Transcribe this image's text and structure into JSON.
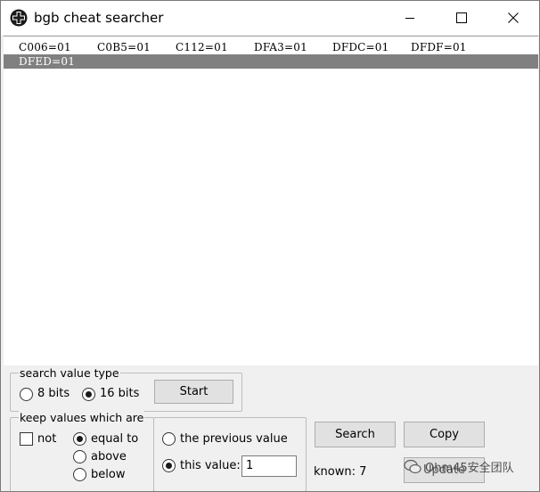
{
  "window": {
    "title": "bgb cheat searcher"
  },
  "results": {
    "rows": [
      [
        "C006=01",
        "C0B5=01",
        "C112=01",
        "DFA3=01",
        "DFDC=01",
        "DFDF=01"
      ],
      [
        "DFED=01"
      ]
    ],
    "selected_row": 1
  },
  "search_value_type": {
    "label": "search value type",
    "options": [
      {
        "label": "8 bits",
        "checked": false
      },
      {
        "label": "16 bits",
        "checked": true
      }
    ],
    "start_label": "Start"
  },
  "keep_values": {
    "label": "keep values which are",
    "not_label": "not",
    "not_checked": false,
    "comparisons": [
      {
        "label": "equal to",
        "checked": true
      },
      {
        "label": "above",
        "checked": false
      },
      {
        "label": "below",
        "checked": false
      }
    ]
  },
  "compare_target": {
    "options": [
      {
        "label": "the previous value",
        "checked": false
      },
      {
        "label": "this value:",
        "checked": true
      }
    ],
    "value": "1"
  },
  "actions": {
    "search_label": "Search",
    "copy_label": "Copy",
    "update_label": "Update"
  },
  "status": {
    "known_text": "known: 7"
  },
  "watermark": {
    "text": "Ohm45安全团队"
  },
  "icons": {
    "app": "cross-icon",
    "minimize": "minimize-icon",
    "maximize": "maximize-icon",
    "close": "close-icon"
  }
}
